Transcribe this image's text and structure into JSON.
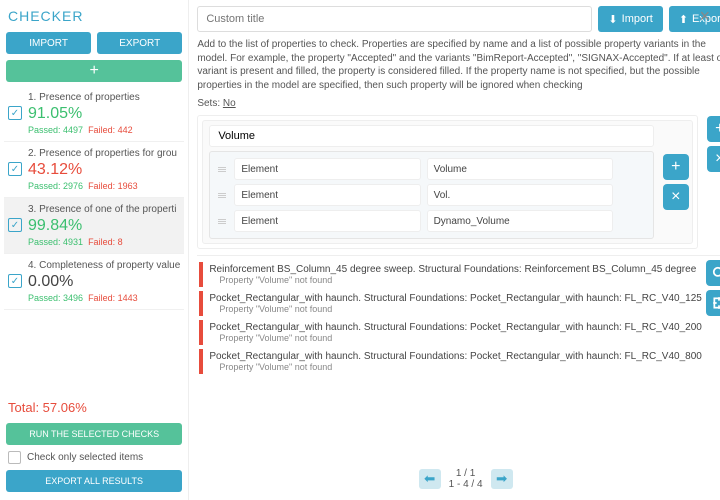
{
  "header": {
    "title": "CHECKER"
  },
  "left": {
    "import": "IMPORT",
    "export": "EXPORT",
    "checks": [
      {
        "idx": "1",
        "name": "1. Presence of properties",
        "pct": "91.05%",
        "pctClass": "pct-green",
        "passed": "Passed: 4497",
        "failed": "Failed: 442",
        "checked": true
      },
      {
        "idx": "2",
        "name": "2. Presence of properties for grou",
        "pct": "43.12%",
        "pctClass": "pct-red",
        "passed": "Passed: 2976",
        "failed": "Failed: 1963",
        "checked": true
      },
      {
        "idx": "3",
        "name": "3. Presence of one of the properti",
        "pct": "99.84%",
        "pctClass": "pct-green",
        "passed": "Passed: 4931",
        "failed": "Failed: 8",
        "checked": true,
        "selected": true
      },
      {
        "idx": "4",
        "name": "4. Completeness of property value",
        "pct": "0.00%",
        "pctClass": "pct-dark",
        "passed": "Passed: 3496",
        "failed": "Failed: 1443",
        "checked": true
      }
    ],
    "total": "Total: 57.06%",
    "run": "RUN THE SELECTED CHECKS",
    "checkOnly": "Check only selected items",
    "exportAll": "EXPORT ALL RESULTS"
  },
  "right": {
    "titlePlaceholder": "Custom title",
    "import": "Import",
    "export": "Export",
    "desc": "Add to the list of properties to check. Properties are specified by name and a list of possible property variants in the model. For example, the property \"Accepted\" and the variants \"BimReport-Accepted\", \"SIGNAX-Accepted\". If at least one variant is present and filled, the property is considered filled. If the property name is not specified, but the possible properties in the model are specified, then such property will be ignored when checking",
    "setsLabel": "Sets:",
    "setsValue": "No",
    "group": {
      "title": "Volume",
      "rows": [
        {
          "a": "Element",
          "b": "Volume"
        },
        {
          "a": "Element",
          "b": "Vol."
        },
        {
          "a": "Element",
          "b": "Dynamo_Volume"
        }
      ]
    },
    "errors": [
      {
        "main": "Reinforcement BS_Column_45 degree sweep. Structural Foundations: Reinforcement BS_Column_45 degree",
        "sub": "Property \"Volume\" not found"
      },
      {
        "main": "Pocket_Rectangular_with haunch. Structural Foundations: Pocket_Rectangular_with haunch: FL_RC_V40_125",
        "sub": "Property \"Volume\" not found"
      },
      {
        "main": "Pocket_Rectangular_with haunch. Structural Foundations: Pocket_Rectangular_with haunch: FL_RC_V40_200",
        "sub": "Property \"Volume\" not found"
      },
      {
        "main": "Pocket_Rectangular_with haunch. Structural Foundations: Pocket_Rectangular_with haunch: FL_RC_V40_800",
        "sub": "Property \"Volume\" not found"
      }
    ],
    "pager": {
      "page": "1 / 1",
      "range": "1 - 4 / 4"
    }
  }
}
